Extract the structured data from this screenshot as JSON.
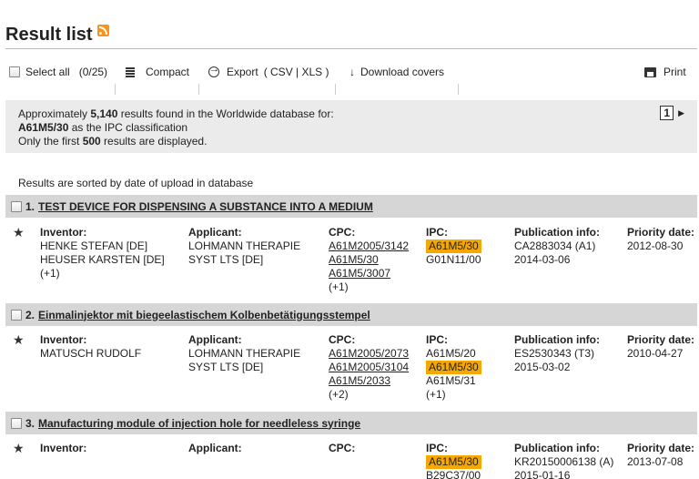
{
  "header": {
    "title": "Result list",
    "feed_icon": "rss-feed-icon"
  },
  "toolbar": {
    "select_all": "Select all",
    "select_count": "(0/25)",
    "compact": "Compact",
    "export": "Export",
    "export_formats": "( CSV | XLS )",
    "download_covers": "Download covers",
    "print": "Print"
  },
  "info": {
    "line1_pre": "Approximately ",
    "count": "5,140",
    "line1_post": " results found in the Worldwide database for:",
    "query_code": "A61M5/30",
    "line2_post": " as the IPC classification",
    "line3_pre": "Only the first ",
    "limit": "500",
    "line3_post": " results are displayed.",
    "page": "1"
  },
  "sorted_text": "Results are sorted by date of upload in database",
  "labels": {
    "inventor": "Inventor:",
    "applicant": "Applicant:",
    "cpc": "CPC:",
    "ipc": "IPC:",
    "publication": "Publication info:",
    "priority": "Priority date:"
  },
  "results": [
    {
      "num": "1.",
      "title": "TEST DEVICE FOR DISPENSING A SUBSTANCE INTO A MEDIUM",
      "inventors": [
        "HENKE STEFAN  [DE]",
        "HEUSER KARSTEN  [DE]",
        "(+1)"
      ],
      "applicant": [
        "LOHMANN THERAPIE",
        "SYST LTS  [DE]"
      ],
      "cpc": [
        "A61M2005/3142",
        "A61M5/30",
        "A61M5/3007"
      ],
      "cpc_more": "(+1)",
      "ipc": [
        "A61M5/30",
        "G01N11/00"
      ],
      "publication": [
        "CA2883034 (A1)",
        "2014-03-06"
      ],
      "priority": "2012-08-30"
    },
    {
      "num": "2.",
      "title": "Einmalinjektor mit biegeelastischem Kolbenbetätigungsstempel",
      "inventors": [
        "MATUSCH RUDOLF"
      ],
      "applicant": [
        "LOHMANN THERAPIE",
        "SYST LTS  [DE]"
      ],
      "cpc": [
        "A61M2005/2073",
        "A61M2005/3104",
        "A61M5/2033"
      ],
      "cpc_more": "(+2)",
      "ipc": [
        "A61M5/20",
        "A61M5/30",
        "A61M5/31",
        "(+1)"
      ],
      "publication": [
        "ES2530343 (T3)",
        "2015-03-02"
      ],
      "priority": "2010-04-27"
    },
    {
      "num": "3.",
      "title": "Manufacturing module of injection hole for needleless syringe",
      "ipc": [
        "A61M5/30",
        "B29C37/00"
      ],
      "publication": [
        "KR20150006138 (A)",
        "2015-01-16"
      ],
      "priority": "2013-07-08"
    }
  ],
  "colors": {
    "highlight": "#f7a800",
    "row_header": "#d6d6d6",
    "info_bg": "#ebebeb"
  }
}
